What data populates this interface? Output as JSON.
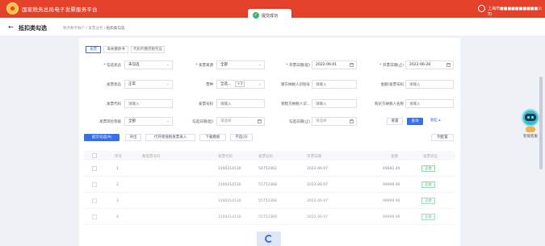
{
  "app": {
    "title": "国家税务总局电子发票服务平台",
    "user": "上海市■■■■■■■■■■公司"
  },
  "toast": {
    "message": "提交成功"
  },
  "header": {
    "back_symbol": "←",
    "page_title": "抵扣类勾选",
    "breadcrumb": [
      "税务数字账户",
      "发票业务",
      "抵扣类勾选"
    ]
  },
  "tabs": [
    {
      "label": "发票",
      "active": true
    },
    {
      "label": "海关缴款书",
      "active": false
    },
    {
      "label": "代扣代缴完税凭证",
      "active": false
    }
  ],
  "filters": {
    "row1": [
      {
        "label": "* 勾选状态",
        "value": "未勾选",
        "kind": "select"
      },
      {
        "label": "* 发票来源",
        "value": "全部",
        "kind": "select"
      },
      {
        "label": "* 开票日期(起)",
        "value": "2022-06-01",
        "kind": "date"
      },
      {
        "label": "* 开票日期(止)",
        "value": "2022-06-28",
        "kind": "date"
      }
    ],
    "row2": [
      {
        "label": "发票状态",
        "value": "正常",
        "kind": "select"
      },
      {
        "label": "票种",
        "value": "全选...",
        "badge": "+3",
        "kind": "multi"
      },
      {
        "label": "销方纳税人识别号",
        "placeholder": "请输入",
        "kind": "input"
      },
      {
        "label": "金额/发票号码",
        "placeholder": "请输入",
        "kind": "input"
      }
    ],
    "row3": [
      {
        "label": "发票代码",
        "placeholder": "请输入",
        "kind": "input"
      },
      {
        "label": "发票号码",
        "placeholder": "请输入",
        "kind": "input"
      },
      {
        "label": "销售方纳税人识...",
        "placeholder": "请输入",
        "kind": "input"
      },
      {
        "label": "购买方纳税人名称",
        "placeholder": "请输入",
        "kind": "input"
      }
    ],
    "row4": [
      {
        "label": "发票风险等级",
        "value": "全部",
        "kind": "select"
      },
      {
        "label": "勾选日期(起)",
        "placeholder": "请选择",
        "kind": "date"
      },
      {
        "label": "勾选日期(止)",
        "placeholder": "请选择",
        "kind": "date"
      }
    ],
    "reset_label": "重置",
    "search_label": "查询",
    "collapse_label": "收起 ▴"
  },
  "toolbar": {
    "buttons": [
      "提交勾选(9)",
      "导出",
      "代开增值税发票录入",
      "下载模板",
      "不选(0)"
    ],
    "column_settings": "列配置"
  },
  "table": {
    "columns": [
      "序号",
      "数电票号码",
      "发票代码",
      "发票号码",
      "开票日期",
      "金额",
      "发票状态"
    ],
    "rows": [
      {
        "index": "1",
        "code": "3100214130",
        "number": "54752462",
        "date": "2022-06-07",
        "amount": "49682.40",
        "status": "正常"
      },
      {
        "index": "2",
        "code": "3100214130",
        "number": "55752368",
        "date": "2022-06-07",
        "amount": "99999.96",
        "status": "正常"
      },
      {
        "index": "3",
        "code": "3100214130",
        "number": "55752368",
        "date": "2022-06-07",
        "amount": "99999.96",
        "status": "正常"
      },
      {
        "index": "4",
        "code": "3100214130",
        "number": "55752369",
        "date": "2022-06-07",
        "amount": "99999.96",
        "status": "正常"
      }
    ]
  },
  "assistant": {
    "label": "智能客服"
  },
  "colors": {
    "brand": "#e4412b",
    "primary": "#3a6ee8",
    "success": "#2e9a5c"
  }
}
